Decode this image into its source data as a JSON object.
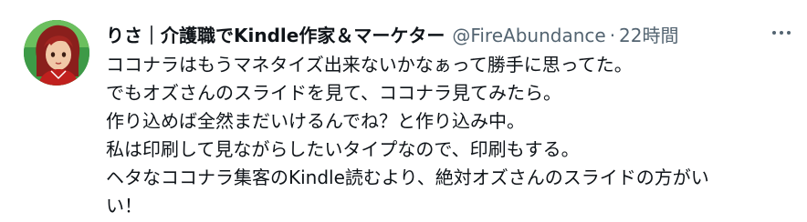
{
  "tweet": {
    "display_name": "りさ｜介護職でKindle作家＆マーケター",
    "handle": "@FireAbundance",
    "separator": "·",
    "time": "22時間",
    "more_icon": "more-horizontal-icon",
    "avatar_icon": "user-avatar",
    "lines": [
      "ココナラはもうマネタイズ出来ないかなぁって勝手に思ってた。",
      "でもオズさんのスライドを見て、ココナラ見てみたら。",
      "作り込めば全然まだいけるんでね？と作り込み中。",
      "私は印刷して見ながらしたいタイプなので、印刷もする。",
      "ヘタなココナラ集客のKindle読むより、絶対オズさんのスライドの方がい",
      "い！"
    ]
  },
  "colors": {
    "text_primary": "#0f1419",
    "text_secondary": "#536471",
    "background": "#ffffff"
  }
}
